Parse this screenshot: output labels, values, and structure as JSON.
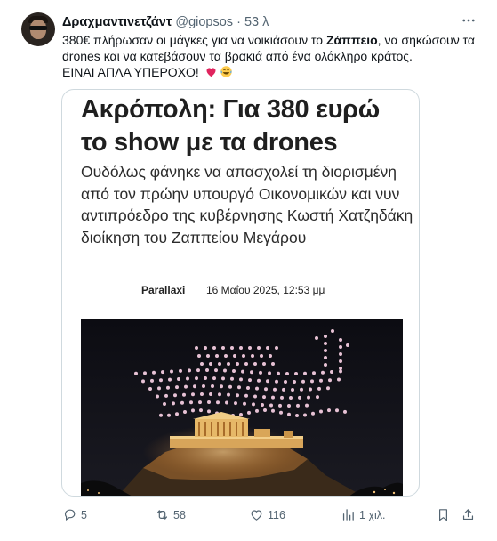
{
  "tweet": {
    "author_name": "Δραχμαντινετζάντ",
    "handle": "@giopsos",
    "separator": "·",
    "time": "53 λ",
    "text_part1": "380€ πλήρωσαν οι μάγκες για να νοικιάσουν το ",
    "text_bold": "Ζάππειο",
    "text_part2": ", να σηκώσουν τα drones και να κατεβάσουν τα βρακιά από ένα ολόκληρο κράτος.",
    "text_line2": "ΕΙΝΑΙ ΑΠΛΑ ΥΠΕΡΟΧΟ!",
    "emojis": [
      "red-heart",
      "face-with-tears-of-joy"
    ],
    "more_icon": "more-horizontal-icon"
  },
  "card": {
    "title": "Ακρόπολη: Για 380 ευρώ το show με τα drones",
    "subtitle": "Ουδόλως φάνηκε να απασχολεί τη διορισμένη από τον πρώην υπουργό Οικονομικών και νυν αντιπρόεδρο της κυβέρνησης Κωστή Χατζηδάκη διοίκηση του Ζαππείου Μεγάρου",
    "source": "Parallaxi",
    "date": "16 Μαΐου 2025, 12:53 μμ"
  },
  "actions": {
    "replies": "5",
    "retweets": "58",
    "likes": "116",
    "views": "1 χιλ.",
    "icons": [
      "reply-icon",
      "retweet-icon",
      "like-icon",
      "views-icon",
      "bookmark-icon",
      "share-icon"
    ]
  },
  "colors": {
    "text": "#0f1419",
    "secondary": "#536471",
    "border": "#cfd9de",
    "heart": "#e0245e"
  }
}
